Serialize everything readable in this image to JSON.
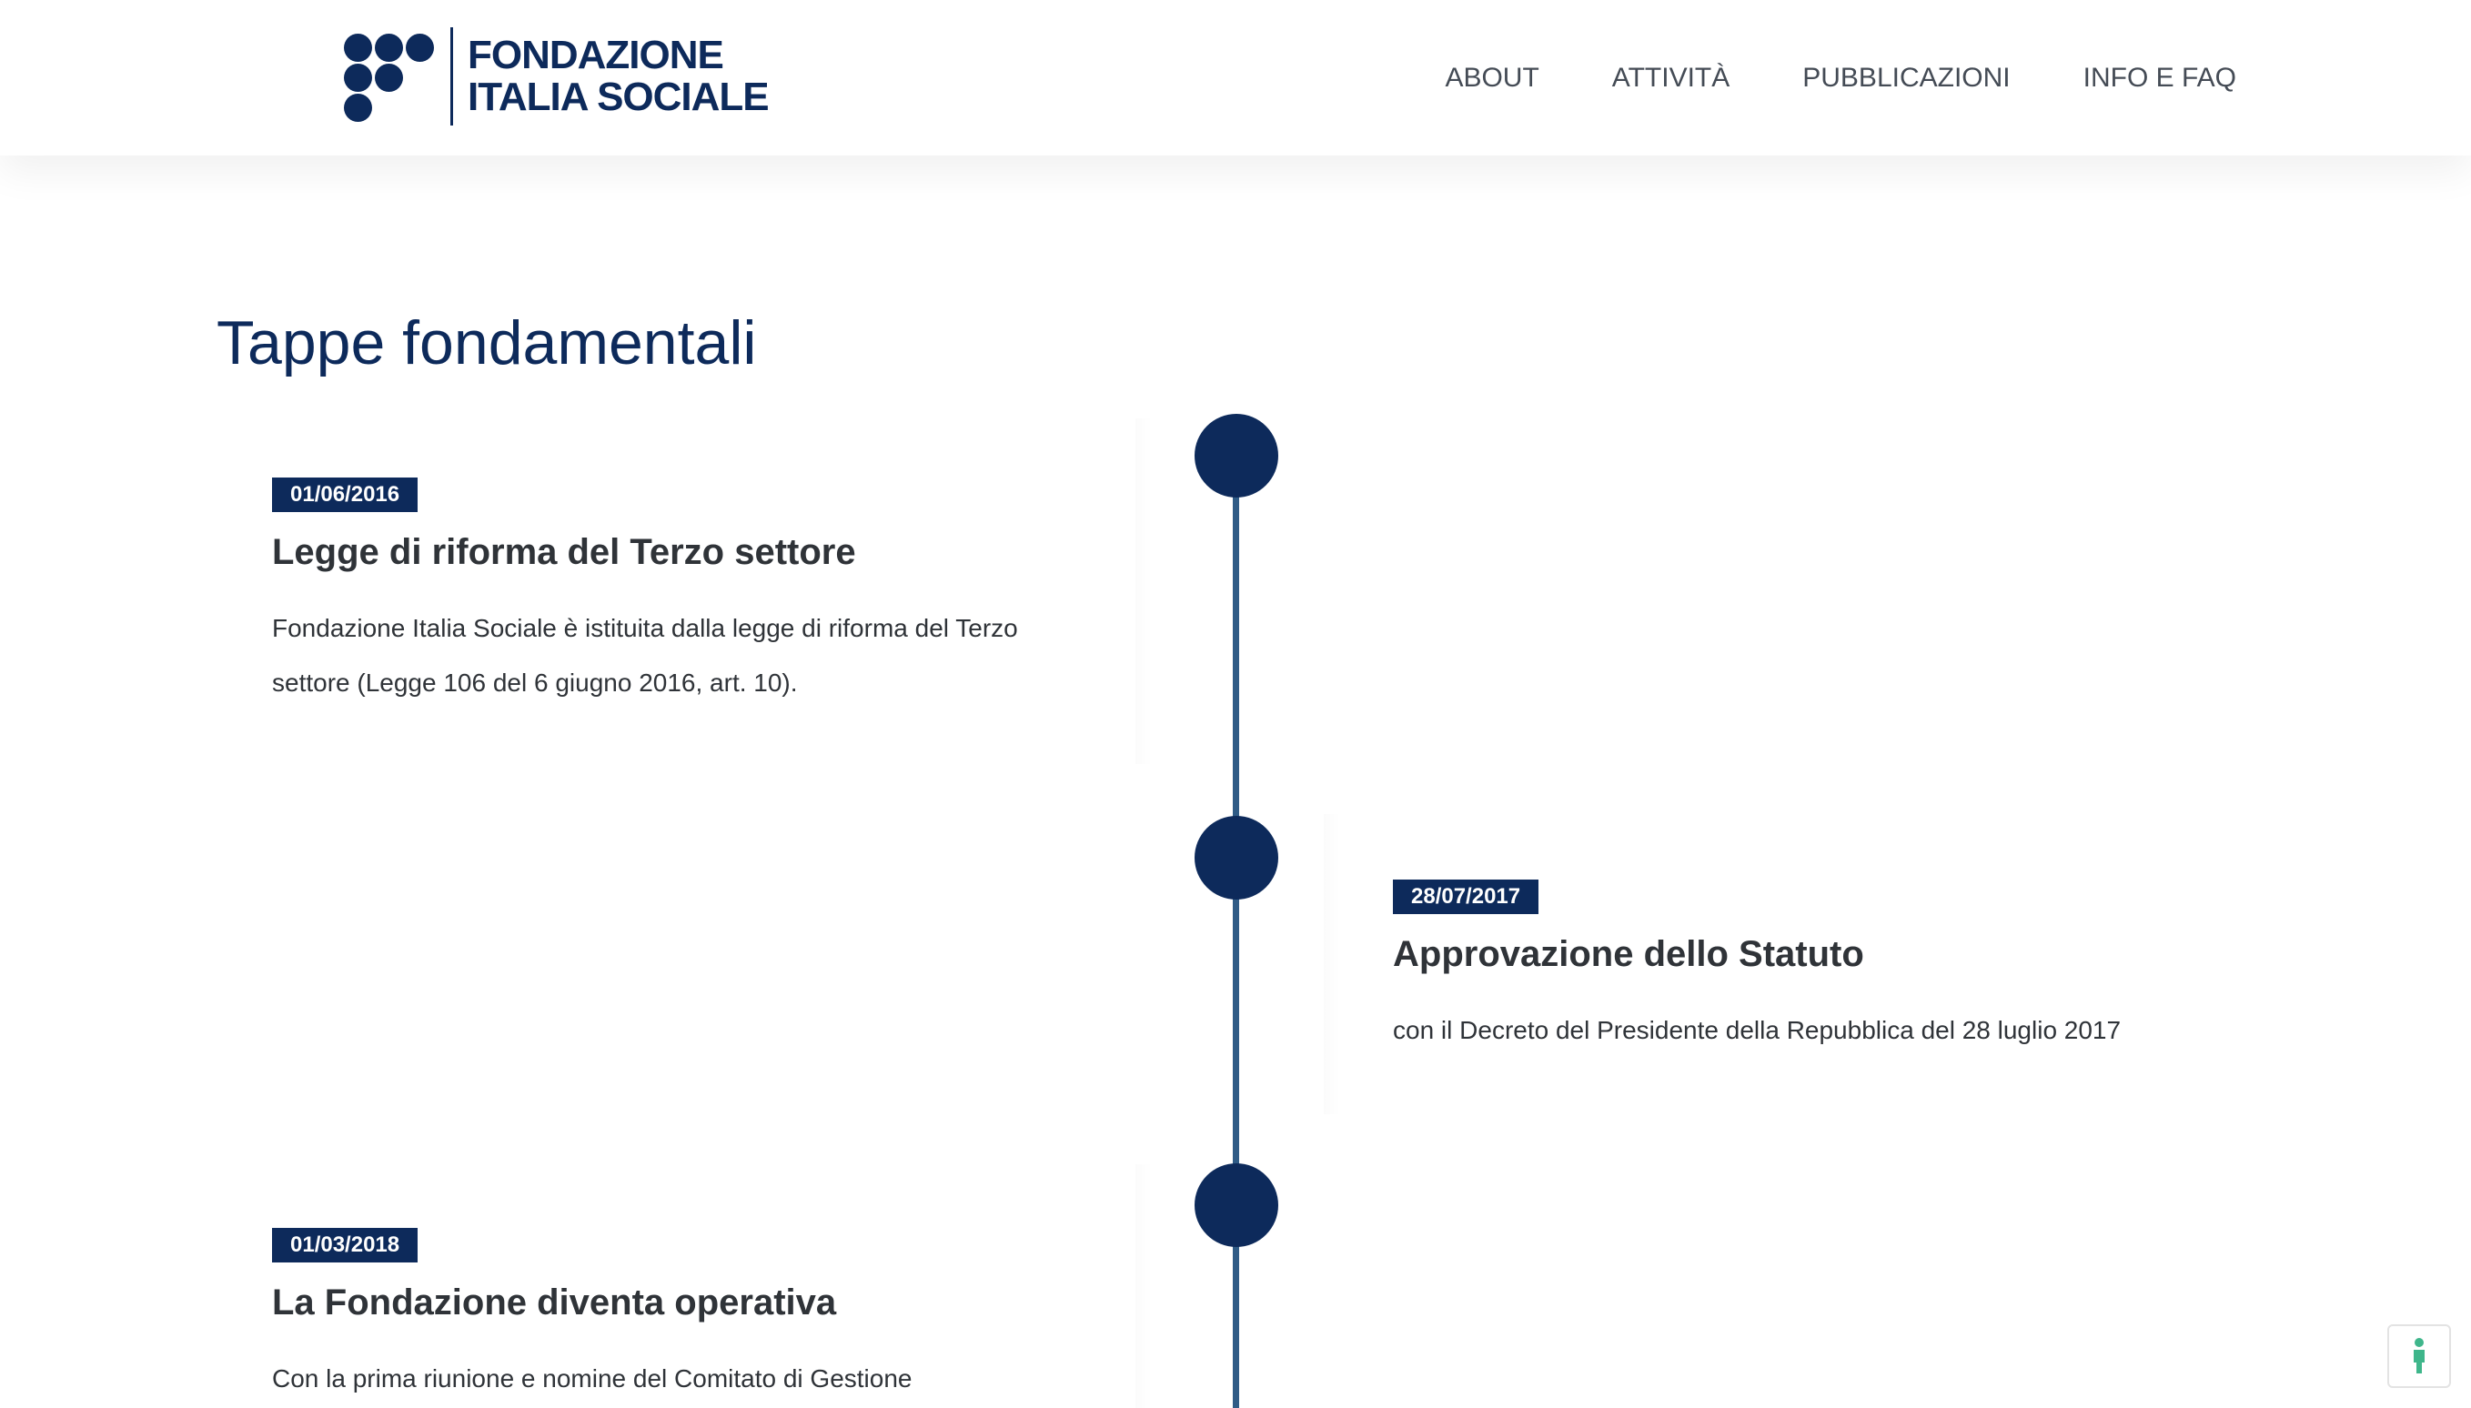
{
  "brand": {
    "line1": "FONDAZIONE",
    "line2": "ITALIA SOCIALE",
    "color": "#0d2a5b"
  },
  "nav": {
    "items": [
      {
        "label": "ABOUT"
      },
      {
        "label": "ATTIVITÀ"
      },
      {
        "label": "PUBBLICAZIONI"
      },
      {
        "label": "INFO E FAQ"
      }
    ]
  },
  "section": {
    "title": "Tappe fondamentali"
  },
  "timeline": {
    "line_color": "#2f5b86",
    "dot_color": "#0d2a5b",
    "entries": [
      {
        "date": "01/06/2016",
        "title": "Legge di riforma del Terzo settore",
        "text": "Fondazione Italia Sociale è istituita dalla legge di riforma del Terzo settore (Legge 106 del 6 giugno 2016, art. 10)."
      },
      {
        "date": "28/07/2017",
        "title": "Approvazione dello Statuto",
        "text": "con il Decreto del Presidente della Repubblica del 28 luglio 2017"
      },
      {
        "date": "01/03/2018",
        "title": "La Fondazione diventa operativa",
        "text": "Con la prima riunione e nomine del Comitato di Gestione"
      }
    ]
  },
  "accessibility": {
    "icon": "accessibility-icon",
    "icon_color": "#3fb68b"
  }
}
